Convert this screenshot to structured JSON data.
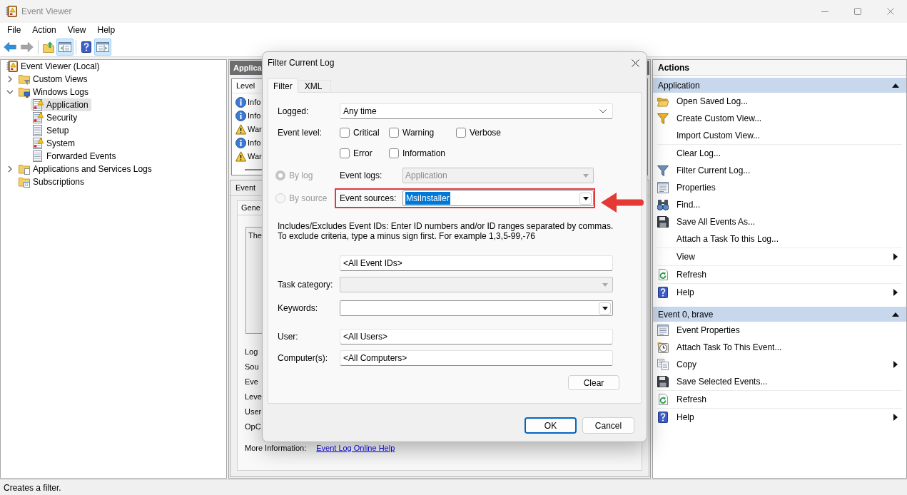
{
  "window": {
    "title": "Event Viewer"
  },
  "menu": [
    "File",
    "Action",
    "View",
    "Help"
  ],
  "toolbar": [
    [
      {
        "disabled": false,
        "pressed": false
      },
      {
        "disabled": true,
        "pressed": false
      }
    ],
    [
      {
        "disabled": false,
        "pressed": false
      },
      {
        "disabled": false,
        "pressed": true
      }
    ],
    [
      {
        "disabled": false,
        "pressed": false
      },
      {
        "disabled": false,
        "pressed": true
      }
    ]
  ],
  "tree": {
    "label": "Event Viewer (Local)",
    "selected": false,
    "children": [
      {
        "label": "Custom Views",
        "selected": false,
        "expanded": false
      },
      {
        "label": "Windows Logs",
        "selected": false,
        "expanded": true,
        "children": [
          {
            "label": "Application",
            "selected": true
          },
          {
            "label": "Security",
            "selected": false
          },
          {
            "label": "Setup",
            "selected": false
          },
          {
            "label": "System",
            "selected": false
          },
          {
            "label": "Forwarded Events",
            "selected": false
          }
        ]
      },
      {
        "label": "Applications and Services Logs",
        "selected": false,
        "expanded": false
      },
      {
        "label": "Subscriptions",
        "selected": false
      }
    ]
  },
  "log_view": {
    "title": "Applica",
    "list": {
      "column": "Level",
      "rows": [
        {
          "kind": "info",
          "text": "Info"
        },
        {
          "kind": "info",
          "text": "Info"
        },
        {
          "kind": "warning",
          "text": "War"
        },
        {
          "kind": "info",
          "text": "Info"
        },
        {
          "kind": "warning",
          "text": "War"
        }
      ]
    }
  },
  "event_panel": {
    "title": "Event",
    "tab": "Gene",
    "message": "The",
    "fields": [
      "Log",
      "Sou",
      "Eve",
      "Leve",
      "User",
      "OpC"
    ],
    "more_info": {
      "label": "More Information:",
      "link": "Event Log Online Help"
    }
  },
  "dialog": {
    "title": "Filter Current Log",
    "tabs": [
      {
        "label": "Filter",
        "selected": true
      },
      {
        "label": "XML",
        "selected": false
      }
    ],
    "logged": {
      "label": "Logged:",
      "value": "Any time"
    },
    "event_level": {
      "label": "Event level:",
      "options": [
        {
          "label": "Critical",
          "checked": false
        },
        {
          "label": "Warning",
          "checked": false
        },
        {
          "label": "Verbose",
          "checked": false
        },
        {
          "label": "Error",
          "checked": false
        },
        {
          "label": "Information",
          "checked": false
        }
      ]
    },
    "scope": [
      {
        "label": "By log",
        "selected": true,
        "disabled": true,
        "field_label": "Event logs:",
        "value": "Application",
        "field_disabled": true,
        "highlighted": false,
        "value_selected": false
      },
      {
        "label": "By source",
        "selected": false,
        "disabled": true,
        "field_label": "Event sources:",
        "value": "MsiInstaller",
        "field_disabled": false,
        "highlighted": true,
        "value_selected": true
      }
    ],
    "description": "Includes/Excludes Event IDs: Enter ID numbers and/or ID ranges separated by commas. To exclude criteria, type a minus sign first. For example 1,3,5-99,-76",
    "event_ids": {
      "value": "<All Event IDs>"
    },
    "fields": [
      {
        "kind": "select",
        "label": "Task category:",
        "disabled": true
      },
      {
        "kind": "select",
        "label": "Keywords:",
        "disabled": false
      },
      {
        "kind": "text",
        "label": "User:",
        "value": "<All Users>",
        "disabled": false
      },
      {
        "kind": "text",
        "label": "Computer(s):",
        "value": "<All Computers>",
        "disabled": false
      }
    ],
    "clear_button": "Clear",
    "buttons": [
      {
        "label": "OK",
        "default": true
      },
      {
        "label": "Cancel",
        "default": false
      }
    ]
  },
  "actions": {
    "title": "Actions",
    "sections": [
      {
        "title": "Application",
        "expanded": true,
        "groups": [
          [
            {
              "label": "Open Saved Log...",
              "submenu": false
            },
            {
              "label": "Create Custom View...",
              "submenu": false
            },
            {
              "label": "Import Custom View...",
              "submenu": false
            }
          ],
          [
            {
              "label": "Clear Log...",
              "submenu": false
            },
            {
              "label": "Filter Current Log...",
              "submenu": false
            },
            {
              "label": "Properties",
              "submenu": false
            },
            {
              "label": "Find...",
              "submenu": false
            },
            {
              "label": "Save All Events As...",
              "submenu": false
            },
            {
              "label": "Attach a Task To this Log...",
              "submenu": false
            }
          ],
          [
            {
              "label": "View",
              "submenu": true
            }
          ],
          [
            {
              "label": "Refresh",
              "submenu": false
            }
          ],
          [
            {
              "label": "Help",
              "submenu": true
            }
          ]
        ]
      },
      {
        "title": "Event 0, brave",
        "expanded": true,
        "groups": [
          [
            {
              "label": "Event Properties",
              "submenu": false
            },
            {
              "label": "Attach Task To This Event...",
              "submenu": false
            },
            {
              "label": "Copy",
              "submenu": true
            },
            {
              "label": "Save Selected Events...",
              "submenu": false
            }
          ],
          [
            {
              "label": "Refresh",
              "submenu": false
            }
          ],
          [
            {
              "label": "Help",
              "submenu": true
            }
          ]
        ]
      }
    ]
  },
  "status_bar": "Creates a filter."
}
